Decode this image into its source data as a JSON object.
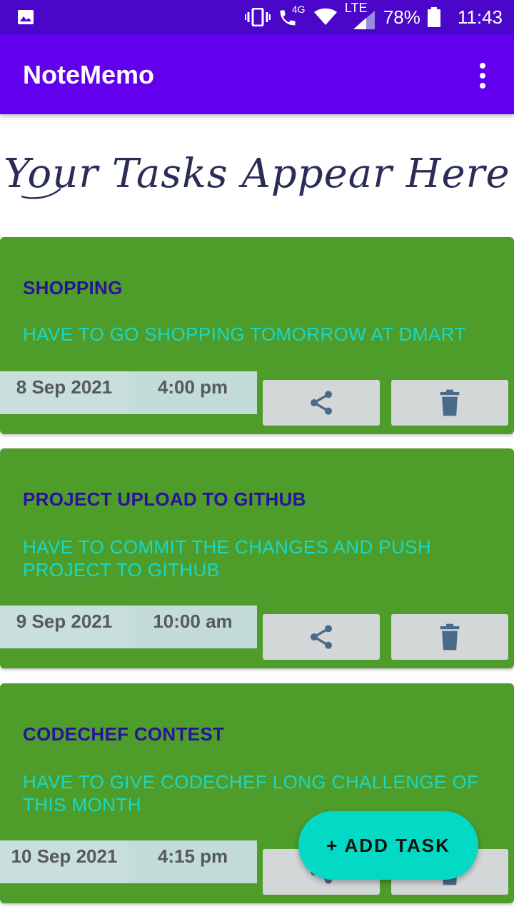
{
  "status_bar": {
    "network": "4G",
    "lte": "LTE",
    "battery": "78%",
    "time": "11:43"
  },
  "app_bar": {
    "title": "NoteMemo",
    "overflow_icon": "more-vert-icon"
  },
  "banner": {
    "text": "Your Tasks Appear Here"
  },
  "tasks": [
    {
      "title": "SHOPPING",
      "description": "HAVE TO GO SHOPPING TOMORROW AT DMART",
      "date": "8 Sep 2021",
      "time": "4:00 pm"
    },
    {
      "title": "PROJECT UPLOAD TO GITHUB",
      "description": "HAVE TO COMMIT THE CHANGES AND PUSH PROJECT TO GITHUB",
      "date": "9 Sep 2021",
      "time": "10:00 am"
    },
    {
      "title": "CODECHEF CONTEST",
      "description": "HAVE TO GIVE CODECHEF LONG CHALLENGE OF THIS MONTH",
      "date": "10 Sep 2021",
      "time": "4:15 pm"
    }
  ],
  "fab": {
    "label": "+ ADD TASK"
  },
  "colors": {
    "primary": "#6200ee",
    "status_bar": "#4a07c9",
    "card": "#4e9c2a",
    "title_text": "#2a139a",
    "desc_text": "#18d8c8",
    "accent": "#03dac6",
    "icon": "#4a6a8a"
  }
}
